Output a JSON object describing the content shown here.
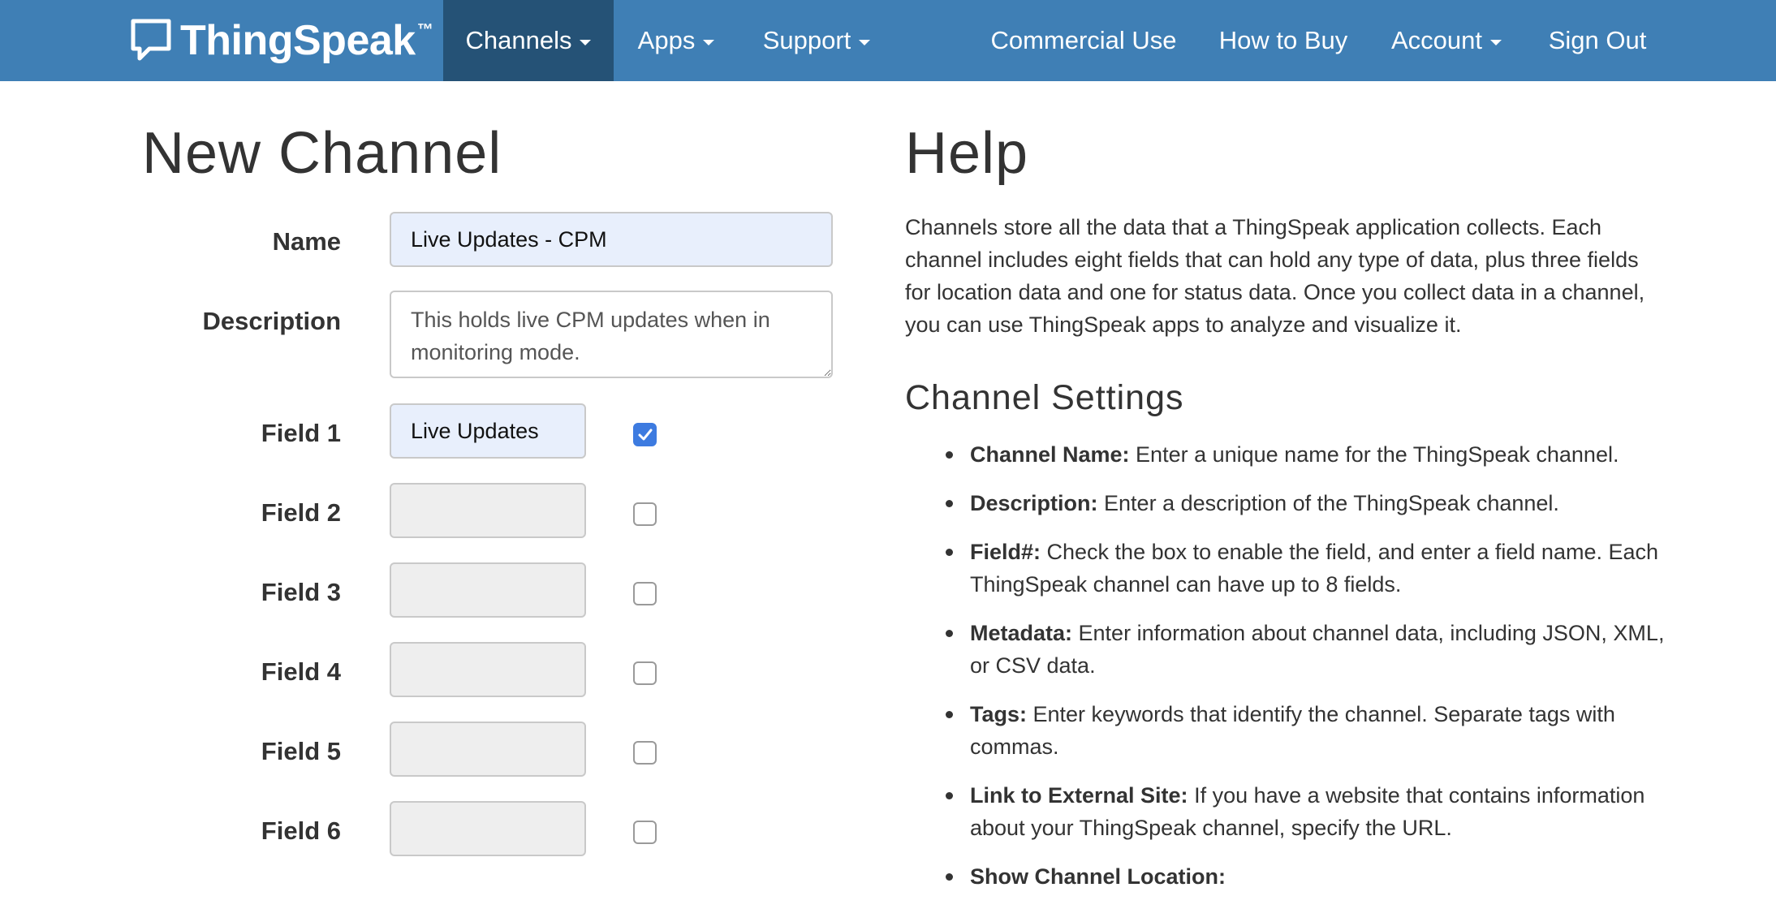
{
  "navbar": {
    "brand": "ThingSpeak",
    "brand_tm": "™",
    "items": [
      {
        "label": "Channels"
      },
      {
        "label": "Apps"
      },
      {
        "label": "Support"
      },
      {
        "label": "Commercial Use"
      },
      {
        "label": "How to Buy"
      },
      {
        "label": "Account"
      },
      {
        "label": "Sign Out"
      }
    ]
  },
  "form": {
    "title": "New Channel",
    "name_label": "Name",
    "name_value": "Live Updates - CPM",
    "description_label": "Description",
    "description_value": "This holds live CPM updates when in monitoring mode.",
    "fields": [
      {
        "label": "Field 1",
        "value": "Live Updates",
        "checked": true
      },
      {
        "label": "Field 2",
        "value": "",
        "checked": false
      },
      {
        "label": "Field 3",
        "value": "",
        "checked": false
      },
      {
        "label": "Field 4",
        "value": "",
        "checked": false
      },
      {
        "label": "Field 5",
        "value": "",
        "checked": false
      },
      {
        "label": "Field 6",
        "value": "",
        "checked": false
      }
    ]
  },
  "help": {
    "title": "Help",
    "intro": "Channels store all the data that a ThingSpeak application collects. Each channel includes eight fields that can hold any type of data, plus three fields for location data and one for status data. Once you collect data in a channel, you can use ThingSpeak apps to analyze and visualize it.",
    "section_title": "Channel Settings",
    "items": [
      {
        "term": "Channel Name:",
        "text": " Enter a unique name for the ThingSpeak channel."
      },
      {
        "term": "Description:",
        "text": " Enter a description of the ThingSpeak channel."
      },
      {
        "term": "Field#:",
        "text": " Check the box to enable the field, and enter a field name. Each ThingSpeak channel can have up to 8 fields."
      },
      {
        "term": "Metadata:",
        "text": " Enter information about channel data, including JSON, XML, or CSV data."
      },
      {
        "term": "Tags:",
        "text": " Enter keywords that identify the channel. Separate tags with commas."
      },
      {
        "term": "Link to External Site:",
        "text": " If you have a website that contains information about your ThingSpeak channel, specify the URL."
      },
      {
        "term": "Show Channel Location:",
        "text": ""
      }
    ]
  },
  "colors": {
    "navbar": "#3f7fb5",
    "navbar_active": "#255276",
    "checkbox_checked": "#3d7be0",
    "input_filled": "#e8effc",
    "input_empty": "#eeeeee"
  }
}
